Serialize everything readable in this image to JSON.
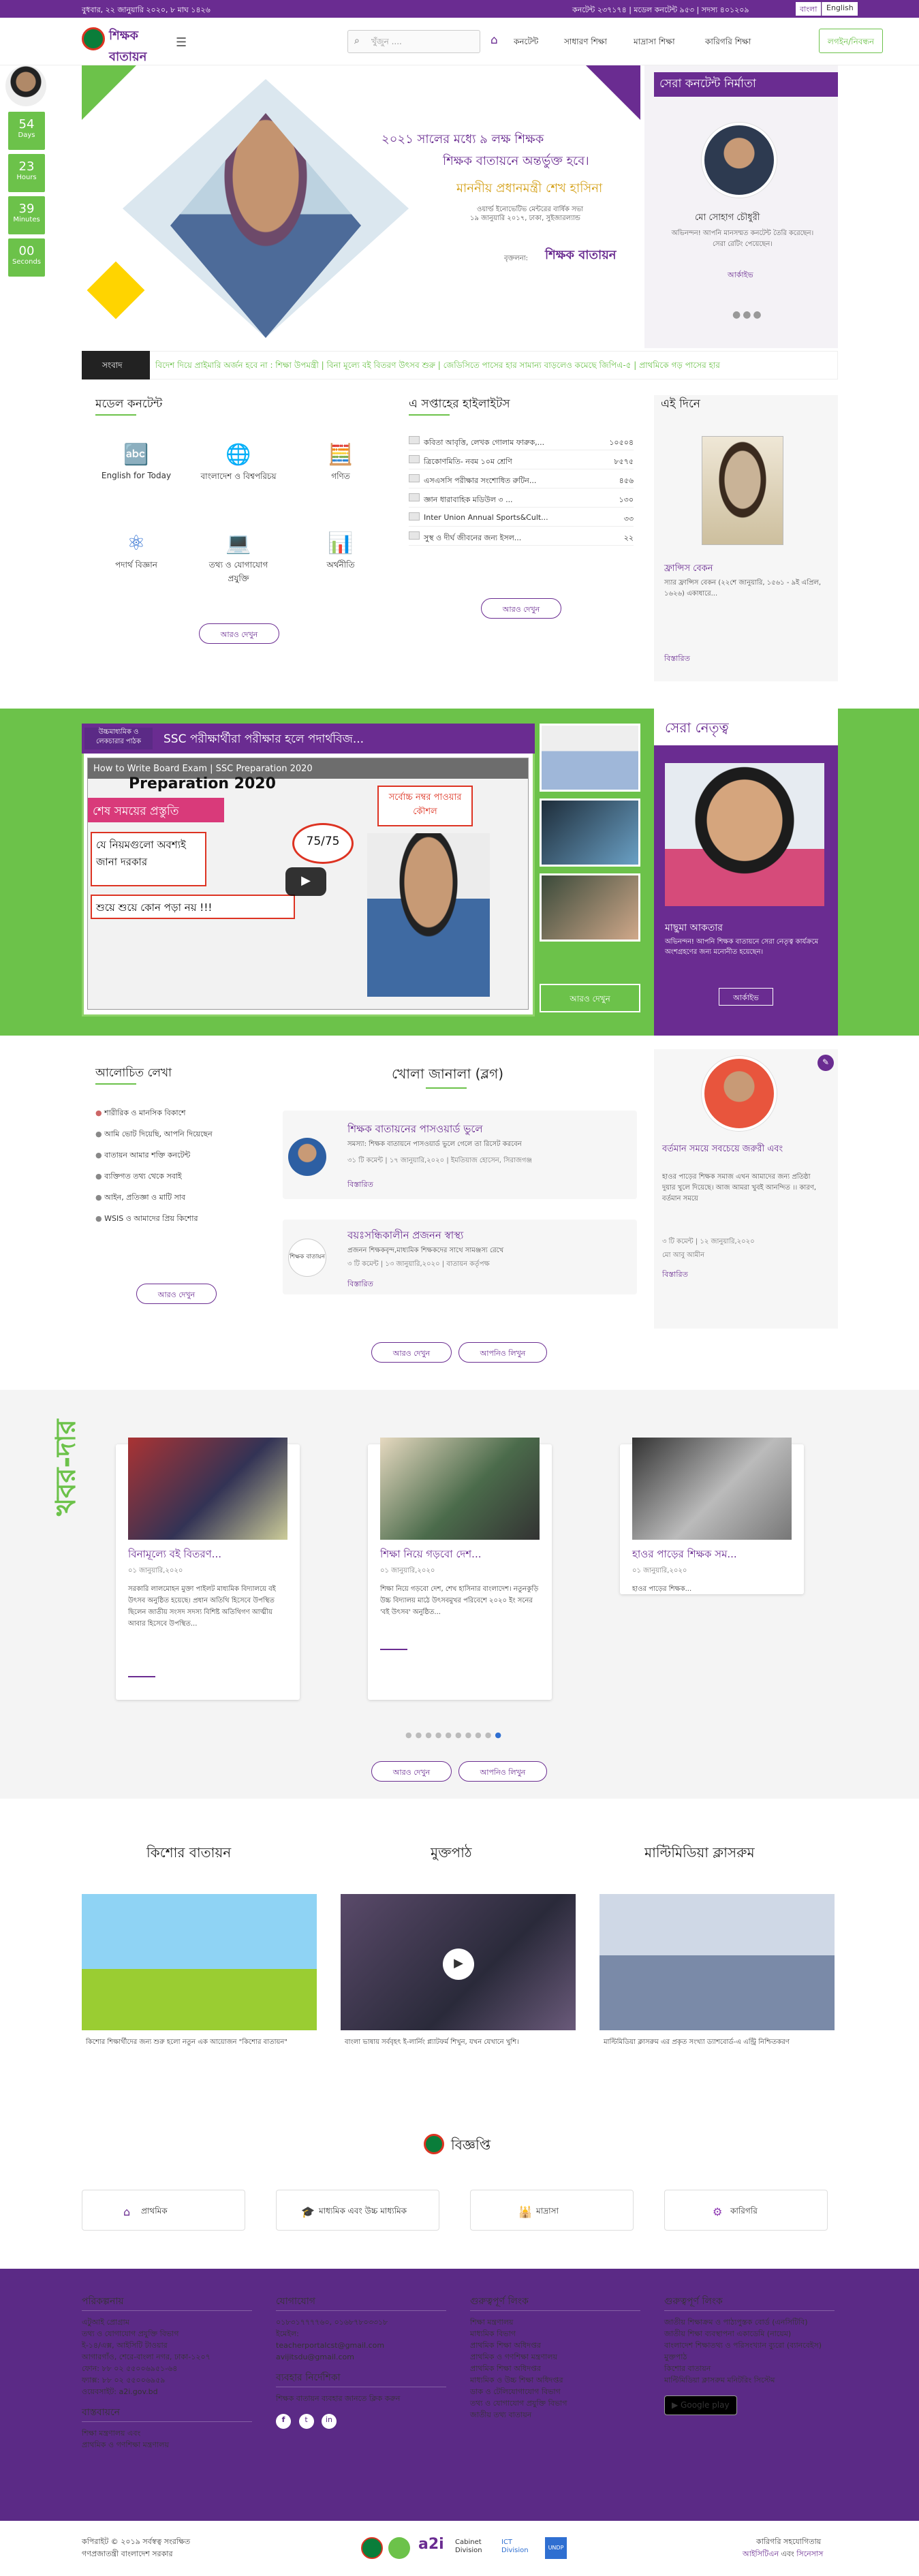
{
  "topbar": {
    "date": "বুধবার, ২২ জানুয়ারি ২০২০, ৮ মাঘ ১৪২৬",
    "stats": "কনটেন্ট ২৩৭১৭৪ | মডেল কনটেন্ট ৯৫৩ | সদস্য ৪০১২০৯",
    "lang_bn": "বাংলা",
    "lang_en": "English"
  },
  "header": {
    "logo_text": "শিক্ষক বাতায়ন",
    "search_placeholder": "খুঁজুন ....",
    "nav": [
      "কনটেন্ট",
      "সাধারণ শিক্ষা",
      "মাদ্রাসা শিক্ষা",
      "কারিগরি শিক্ষা"
    ],
    "nav_button": "লগইন/নিবন্ধন"
  },
  "countdown": [
    {
      "num": "54",
      "label": "Days"
    },
    {
      "num": "23",
      "label": "Hours"
    },
    {
      "num": "39",
      "label": "Minutes"
    },
    {
      "num": "00",
      "label": "Seconds"
    }
  ],
  "hero": {
    "line1": "২০২১ সালের মধ্যে ৯ লক্ষ শিক্ষক",
    "line2": "শিক্ষক বাতায়নে অন্তর্ভুক্ত হবে।",
    "name": "মাননীয় প্রধানমন্ত্রী শেখ হাসিনা",
    "sub1": "ওয়ার্ল্ড ইনোভেটিভ মেন্টরের বার্ষিক সভা",
    "sub2": "১৯ জানুয়ারি ২০১৭, ঢাকা, সুইজারল্যান্ড",
    "brand_label": "বৃক্তলনা:",
    "brand": "শিক্ষক বাতায়ন"
  },
  "best_content": {
    "title": "সেরা কনটেন্ট নির্মাতা",
    "name": "মো সোহাগ চৌধুরী",
    "desc": "অভিনন্দন! আপনি মানসম্মত কনটেন্ট তৈরি করেছেন। সেরা রেটিং পেয়েছেন।",
    "button": "আর্কাইভ"
  },
  "ticker": {
    "label": "সংবাদ",
    "text": "বিদেশ দিয়ে প্রাইমারি অর্জন হবে না : শিক্ষা উপমন্ত্রী   |   বিনা মূল্যে বই বিতরণ উৎসব শুরু   |   জেডিসিতে পাসের হার সামান্য বাড়লেও কমেছে জিপিএ-৫   |   প্রাথমিকে গড় পাসের হার"
  },
  "model_content": {
    "title": "মডেল কনটেন্ট",
    "items": [
      "English for Today",
      "বাংলাদেশ ও বিশ্বপরিচয়",
      "গণিত",
      "পদার্থ বিজ্ঞান",
      "তথ্য ও যোগাযোগ প্রযুক্তি",
      "অর্থনীতি"
    ],
    "more": "আরও দেখুন"
  },
  "highlights": {
    "title": "এ সপ্তাহের হাইলাইটস",
    "items": [
      {
        "t": "কবিতা আবৃত্তি, লেখক গোলাম ফারুক,...",
        "n": "১০৫০৪"
      },
      {
        "t": "ত্রিকোণমিতি- নবম ১০ম শ্রেণি",
        "n": "৮৫৭৫"
      },
      {
        "t": "এসএসসি পরীক্ষার সংশোধিত রুটিন...",
        "n": "৪৫৬"
      },
      {
        "t": "জ্ঞান ধারাবাহিক মডিউল ৩ ...",
        "n": "১৩০"
      },
      {
        "t": "Inter Union Annual Sports&Cult...",
        "n": "৩৩"
      },
      {
        "t": "সুস্থ ও দীর্ঘ জীবনের জন্য ইসল...",
        "n": "২২"
      }
    ],
    "more": "আরও দেখুন"
  },
  "this_day": {
    "title": "এই দিনে",
    "name": "ফ্রান্সিস বেকন",
    "desc": "স্যার ফ্রান্সিস বেকন (২২শে জানুয়ারি, ১৫৬১ - ৯ই এপ্রিল, ১৬২৬) একাধারে...",
    "link": "বিস্তারিত"
  },
  "video": {
    "category": "উচ্চমাধ্যমিক ও লেকচারার পাঠক",
    "title": "SSC পরীক্ষার্থীরা পরীক্ষার হলে পদার্থবিজ...",
    "overlay_title": "How to Write Board Exam | SSC Preparation 2020",
    "overlay1": "Preparation 2020",
    "overlay2": "শেষ সময়ের প্রস্তুতি",
    "overlay3": "যে নিয়মগুলো অবশ্যই জানা দরকার",
    "overlay4": "শুয়ে শুয়ে কোন পড়া নয় !!!",
    "overlay5": "সর্বোচ্চ নম্বর পাওয়ার কৌশল",
    "badge": "75/75",
    "more": "আরও দেখুন"
  },
  "leader": {
    "title": "সেরা নেতৃত্ব",
    "name": "মাছুমা আকতার",
    "desc": "অভিনন্দন! আপনি শিক্ষক বাতায়নে সেরা নেতৃত্ব কার্যক্রমে অংশগ্রহণের জন্য মনোনীত হয়েছেন।",
    "button": "আর্কাইভ"
  },
  "discussed": {
    "title": "আলোচিত লেখা",
    "items": [
      "শারীরিক ও মানসিক বিকাশে",
      "আমি ভোট দিয়েছি, আপনি দিয়েছেন",
      "বাতায়ন আমার শক্তি কনটেন্ট",
      "ব্যক্তিগত তথ্য থেকে সবাই",
      "আইন, প্রতিজ্ঞা ও মাটি সাব",
      "WSIS ও আমাদের প্রিয় কিশোর"
    ],
    "more": "আরও দেখুন"
  },
  "blog": {
    "title": "খোলা জানালা (ব্লগ)",
    "posts": [
      {
        "title": "শিক্ষক বাতায়নের পাসওয়ার্ড ভুলে",
        "excerpt": "সমস্যা: শিক্ষক বাতায়নে পাসওয়ার্ড ভুলে গেলে তা রিসেট করবেন",
        "meta": "৩১ টি কমেন্ট  |  ১৭ জানুয়ারি,২০২০  |  ইমতিয়াজ হোসেন, সিরাজগঞ্জ",
        "link": "বিস্তারিত"
      },
      {
        "title": "বয়ঃসন্ধিকালীন প্রজনন স্বাস্থ্য",
        "excerpt": "প্রজনন শিক্ষকবৃন্দ,মাধ্যমিক শিক্ষকদের সাথে সামঞ্জস্য রেখে",
        "meta": "৩ টি কমেন্ট  |  ১৩ জানুয়ারি,২০২০  |  বাতায়ন কর্তৃপক্ষ",
        "link": "বিস্তারিত",
        "tag": "শিক্ষক বাতায়ন"
      }
    ],
    "more": "আরও দেখুন",
    "write": "আপনিও লিখুন"
  },
  "side_blog": {
    "title": "বর্তমান সময়ে সবচেয়ে জরুরী এবং",
    "excerpt": "হাওর পাড়ের শিক্ষক সমাজ এখন আমাদের জন্য প্রতিষ্ঠা দুয়ার খুলে দিয়েছে। আজ আমরা খুবই আনন্দিত ।। কারণ, বর্তমান সময়ে",
    "meta": "৩ টি কমেন্ট  |  ১২ জানুয়ারি,২০২০",
    "author": "মো আবু আমীন",
    "link": "বিস্তারিত"
  },
  "news": {
    "side_label": "খবর-দার",
    "items": [
      {
        "title": "বিনামূল্যে বই বিতরণ...",
        "date": "০১ জানুয়ারি,২০২০",
        "text": "সরকারি লালমোহন মুক্তা পাইলট মাধ্যমিক বিদ্যালয়ে বই উৎসব অনুষ্ঠিত হয়েছে। প্রধান অতিথি হিসেবে উপস্থিত ছিলেন জাতীয় সংসদ সদস্য বিশিষ্ট অতিথিগণ আত্মীয় আবার হিসেবে উপস্থিত..."
      },
      {
        "title": "শিক্ষা নিয়ে গড়বো দেশ...",
        "date": "০১ জানুয়ারি,২০২০",
        "text": "শিক্ষা নিয়ে গড়বো দেশ, শেখ হাসিনার বাংলাদেশ। নতুনকুড়ি উচ্চ বিদ্যালয় মাঠে উৎসবমুখর পরিবেশে ২০২০ ইং সনের 'বই উৎসব' অনুষ্ঠিত..."
      },
      {
        "title": "হাওর পাড়ের শিক্ষক সম...",
        "date": "০১ জানুয়ারি,২০২০",
        "text": "হাওর পাড়ের শিক্ষক..."
      }
    ],
    "more": "আরও দেখুন",
    "write": "আপনিও লিখুন"
  },
  "media": [
    {
      "title": "কিশোর বাতায়ন",
      "caption": "কিশোর শিক্ষার্থীদের জন্য শুরু হলো নতুন এক আয়োজন \"কিশোর বাতায়ন\""
    },
    {
      "title": "মুক্তপাঠ",
      "caption": "বাংলা ভাষায় সর্ববৃহৎ ই-লার্নিং প্ল্যাটফর্ম শিখুন, যখন যেখানে খুশি।"
    },
    {
      "title": "মাল্টিমিডিয়া ক্লাসরুম",
      "caption": "মাল্টিমিডিয়া ক্লাসরুম এর প্রকৃত সংখ্যা ড্যাশবোর্ড-এ এন্ট্রি নিশ্চিতকরণ"
    }
  ],
  "notices": {
    "title": "বিজ্ঞপ্তি",
    "items": [
      "প্রাথমিক",
      "মাধ্যমিক এবং উচ্চ মাধ্যমিক",
      "মাদ্রাসা",
      "কারিগরি"
    ]
  },
  "footer": {
    "col1_title": "পরিকল্পনায়",
    "col1_lines": [
      "এটুআই প্রোগ্রাম",
      "তথ্য ও যোগাযোগ প্রযুক্তি বিভাগ",
      "ই-১৪/এক্স, আইসিটি টাওয়ার",
      "আগারগাঁও, শেরে-বাংলা নগর, ঢাকা-১২০৭",
      "ফোন: ৮৮ ০২ ৫৫০০৬৯৫১-৬৪",
      "ফ্যাক্স: ৮৮ ০২ ৫৫০০৬৯৫৯",
      "ওয়েবসাইট: a2i.gov.bd"
    ],
    "col1b_title": "বাস্তবায়নে",
    "col1b_lines": [
      "শিক্ষা মন্ত্রণালয় এবং",
      "প্রাথমিক ও গণশিক্ষা মন্ত্রণালয়"
    ],
    "col2_title": "যোগাযোগ",
    "col2_lines": [
      "০১৮৩১৭৭৭৭৬০, ০১৬৮৭৮০৩৩১৮",
      "ইমেইল:",
      "teacherportalcst@gmail.com",
      "avijitsdu@gmail.com"
    ],
    "col2b_title": "ব্যবহার নির্দেশিকা",
    "col2b_line": "শিক্ষক বাতায়ন ব্যবহার জানতে ক্লিক করুন",
    "col3_title": "গুরুত্বপূর্ণ লিংক",
    "col3_lines": [
      "শিক্ষা মন্ত্রণালয়",
      "মাধ্যমিক বিভাগ",
      "প্রাথমিক শিক্ষা অধিদপ্তর",
      "প্রাথমিক ও গণশিক্ষা মন্ত্রণালয়",
      "প্রাথমিক শিক্ষা অধিদপ্তর",
      "মাধ্যমিক ও উচ্চ শিক্ষা অধিদপ্তর",
      "ডাক ও টেলিযোগাযোগ বিভাগ",
      "তথ্য ও যোগাযোগ প্রযুক্তি বিভাগ",
      "জাতীয় তথ্য বাতায়ন"
    ],
    "col4_title": "গুরুত্বপূর্ণ লিংক",
    "col4_lines": [
      "জাতীয় শিক্ষাক্রম ও পাঠ্যপুস্তক বোর্ড (এনসিটিবি)",
      "জাতীয় শিক্ষা ব্যবস্থাপনা একাডেমি (নায়েম)",
      "বাংলাদেশ শিক্ষাতথ্য ও পরিসংখ্যান ব্যুরো (ব্যানবেইস)",
      "মুক্তপাঠ",
      "কিশোর বাতায়ন",
      "মাল্টিমিডিয়া ক্লাসরুম মনিটরিং সিস্টেম"
    ],
    "google_play": "Google play"
  },
  "bottom": {
    "copyright_line1": "কপিরাইট © ২০১৯ সর্বস্বত্ব সংরক্ষিত",
    "copyright_line2": "গণপ্রজাতন্ত্রী বাংলাদেশ সরকার",
    "tech_line1": "কারিগরি সহযোগিতায়",
    "tech_line2a": "আইসিটিএন",
    "tech_line2b": "এবং",
    "tech_line2c": "সিনেসাস",
    "sponsors": [
      "a2i",
      "Cabinet Division",
      "ICT Division",
      "UNDP"
    ]
  }
}
